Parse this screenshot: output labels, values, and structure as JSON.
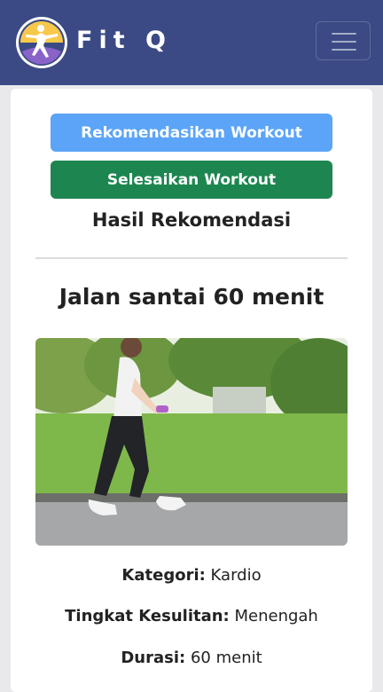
{
  "navbar": {
    "brand": "Fit Q",
    "menu_icon": "hamburger-menu-icon",
    "logo_icon": "fitness-person-logo-icon"
  },
  "actions": {
    "recommend_label": "Rekomendasikan Workout",
    "finish_label": "Selesaikan Workout"
  },
  "result": {
    "heading": "Hasil Rekomendasi",
    "workout_title": "Jalan santai 60 menit",
    "category_label": "Kategori:",
    "category_value": "Kardio",
    "level_label": "Tingkat Kesulitan:",
    "level_value": "Menengah",
    "duration_label": "Durasi:",
    "duration_value": "60 menit"
  },
  "colors": {
    "navbar_bg": "#3b4a84",
    "recommend_button": "#5ba4f7",
    "finish_button": "#1d8650"
  }
}
